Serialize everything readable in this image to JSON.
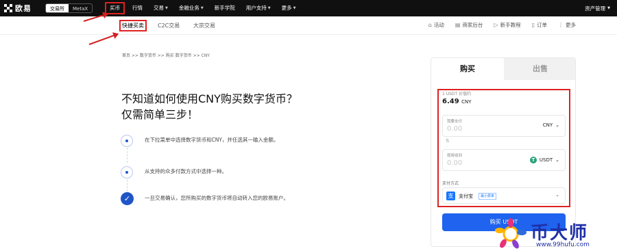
{
  "header": {
    "logo_text": "欧易",
    "switch": {
      "exchange": "交易所",
      "metax": "MetaX"
    },
    "nav": [
      {
        "label": "买币",
        "dropdown": false,
        "active": true
      },
      {
        "label": "行情",
        "dropdown": false
      },
      {
        "label": "交易",
        "dropdown": true
      },
      {
        "label": "金融业务",
        "dropdown": true
      },
      {
        "label": "新手学院",
        "dropdown": false
      },
      {
        "label": "用户支持",
        "dropdown": true
      },
      {
        "label": "更多",
        "dropdown": true
      }
    ],
    "right": {
      "assets_label": "资产管理"
    },
    "chevron": "⌄"
  },
  "subnav": {
    "tabs": [
      "快捷买卖",
      "C2C交易",
      "大宗交易"
    ],
    "right_items": [
      {
        "label": "活动",
        "icon": "gift-icon",
        "glyph": "⌂"
      },
      {
        "label": "商家后台",
        "icon": "merchant-icon",
        "glyph": "▤"
      },
      {
        "label": "新手教程",
        "icon": "video-icon",
        "glyph": "▷"
      },
      {
        "label": "订单",
        "icon": "order-icon",
        "glyph": "▯"
      },
      {
        "label": "更多",
        "icon": "more-icon",
        "glyph": "⋮"
      }
    ]
  },
  "breadcrumb": "首页 >> 数字货币 >> 购买 数字货币 >> CNY",
  "headline": {
    "line1": "不知道如何使用CNY购买数字货币？",
    "line2": "仅需简单三步！"
  },
  "steps": [
    "在下拉菜单中选择数字货币和CNY，并任选其一输入金额。",
    "从支持的众多付款方式中选择一种。",
    "一旦交易确认，您所购买的数字货币将自动转入您的欧易账户。"
  ],
  "trade": {
    "tab_buy": "购买",
    "tab_sell": "出售",
    "price_label": "1 USDT 价值约",
    "price_value": "6.49",
    "price_unit": "CNY",
    "pay": {
      "label": "我要支付",
      "placeholder": "0.00",
      "currency": "CNY"
    },
    "receive": {
      "label": "我将收到",
      "placeholder": "0.00",
      "currency": "USDT",
      "coin_glyph": "T"
    },
    "swap_glyph": "⇅",
    "method_label": "支付方式",
    "method": {
      "name": "支付宝",
      "badge": "最小费率",
      "glyph": "支"
    },
    "buy_button": "购买 USDT"
  },
  "watermark": {
    "title": "币大师",
    "url": "www.99hufu.com"
  },
  "colors": {
    "accent": "#1f63ee",
    "annotation_red": "#e02020",
    "topbar": "#101010"
  }
}
